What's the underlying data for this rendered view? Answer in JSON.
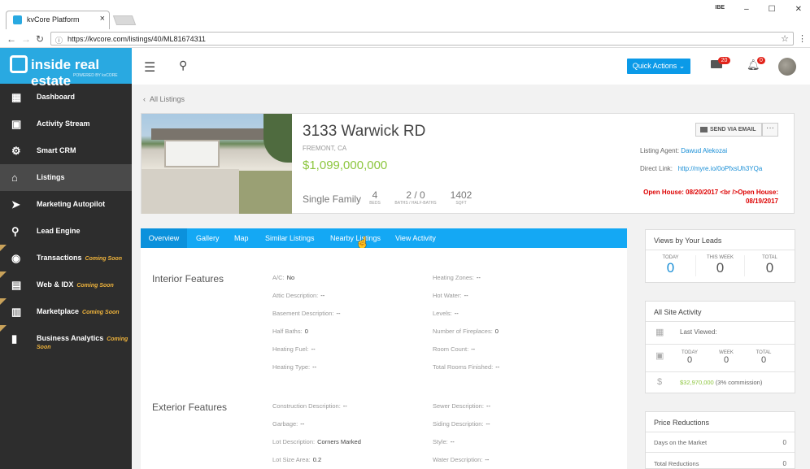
{
  "browser": {
    "tab_title": "kvCore Platform",
    "url": "https://kvcore.com/listings/40/ML81674311",
    "window_user": "IBE"
  },
  "brand": {
    "logo_text": "inside real estate",
    "logo_sub": "POWERED BY kvCORE"
  },
  "sidebar": {
    "items": [
      {
        "label": "Dashboard",
        "icon": "dashboard-icon",
        "soon": ""
      },
      {
        "label": "Activity Stream",
        "icon": "activity-icon",
        "soon": ""
      },
      {
        "label": "Smart CRM",
        "icon": "crm-icon",
        "soon": ""
      },
      {
        "label": "Listings",
        "icon": "home-icon",
        "soon": ""
      },
      {
        "label": "Marketing Autopilot",
        "icon": "paper-plane-icon",
        "soon": ""
      },
      {
        "label": "Lead Engine",
        "icon": "lead-engine-icon",
        "soon": ""
      },
      {
        "label": "Transactions",
        "icon": "transactions-icon",
        "soon": "Coming Soon"
      },
      {
        "label": "Web & IDX",
        "icon": "web-icon",
        "soon": "Coming Soon"
      },
      {
        "label": "Marketplace",
        "icon": "marketplace-icon",
        "soon": "Coming Soon"
      },
      {
        "label": "Business Analytics",
        "icon": "analytics-icon",
        "soon": "Coming Soon"
      }
    ]
  },
  "topbar": {
    "quick_actions": "Quick Actions",
    "mail_count": "20",
    "notif_count": "0"
  },
  "breadcrumb": "All Listings",
  "listing": {
    "address": "3133 Warwick RD",
    "city": "FREMONT, CA",
    "price": "$1,099,000,000",
    "type": "Single Family",
    "beds": "4",
    "beds_label": "BEDS",
    "baths": "2 / 0",
    "baths_label": "BATHS / HALF-BATHS",
    "sqft": "1402",
    "sqft_label": "SQFT",
    "send_email": "SEND VIA EMAIL",
    "more": "···",
    "agent_label": "Listing Agent:",
    "agent_name": "Dawud Alekozai",
    "direct_label": "Direct Link:",
    "direct_url": "http://myre.io/0oPfxsUh3YQa",
    "open_house": "Open House: 08/20/2017 <br />Open House: 08/19/2017"
  },
  "tabs": [
    "Overview",
    "Gallery",
    "Map",
    "Similar Listings",
    "Nearby Listings",
    "View Activity"
  ],
  "interior": {
    "title": "Interior Features",
    "left": [
      {
        "k": "A/C:",
        "v": "No"
      },
      {
        "k": "Attic Description:",
        "v": "--"
      },
      {
        "k": "Basement Description:",
        "v": "--"
      },
      {
        "k": "Half Baths:",
        "v": "0"
      },
      {
        "k": "Heating Fuel:",
        "v": "--"
      },
      {
        "k": "Heating Type:",
        "v": "--"
      }
    ],
    "right": [
      {
        "k": "Heating Zones:",
        "v": "--"
      },
      {
        "k": "Hot Water:",
        "v": "--"
      },
      {
        "k": "Levels:",
        "v": "--"
      },
      {
        "k": "Number of Fireplaces:",
        "v": "0"
      },
      {
        "k": "Room Count:",
        "v": "--"
      },
      {
        "k": "Total Rooms Finished:",
        "v": "--"
      }
    ]
  },
  "exterior": {
    "title": "Exterior Features",
    "left": [
      {
        "k": "Construction Description:",
        "v": "--"
      },
      {
        "k": "Garbage:",
        "v": "--"
      },
      {
        "k": "Lot Description:",
        "v": "Corners Marked"
      },
      {
        "k": "Lot Size Area:",
        "v": "0.2"
      }
    ],
    "right": [
      {
        "k": "Sewer Description:",
        "v": "--"
      },
      {
        "k": "Siding Description:",
        "v": "--"
      },
      {
        "k": "Style:",
        "v": "--"
      },
      {
        "k": "Water Description:",
        "v": "--"
      }
    ]
  },
  "views": {
    "title": "Views by Your Leads",
    "today_label": "TODAY",
    "today": "0",
    "week_label": "THIS WEEK",
    "week": "0",
    "total_label": "TOTAL",
    "total": "0"
  },
  "site_activity": {
    "title": "All Site Activity",
    "last_viewed": "Last Viewed:",
    "today_label": "TODAY",
    "today": "0",
    "week_label": "WEEK",
    "week": "0",
    "total_label": "TOTAL",
    "total": "0",
    "commission_value": "$32,970,000",
    "commission_note": "(3% commission)"
  },
  "price_reductions": {
    "title": "Price Reductions",
    "rows": [
      {
        "k": "Days on the Market",
        "v": "0"
      },
      {
        "k": "Total Reductions",
        "v": "0"
      }
    ]
  }
}
